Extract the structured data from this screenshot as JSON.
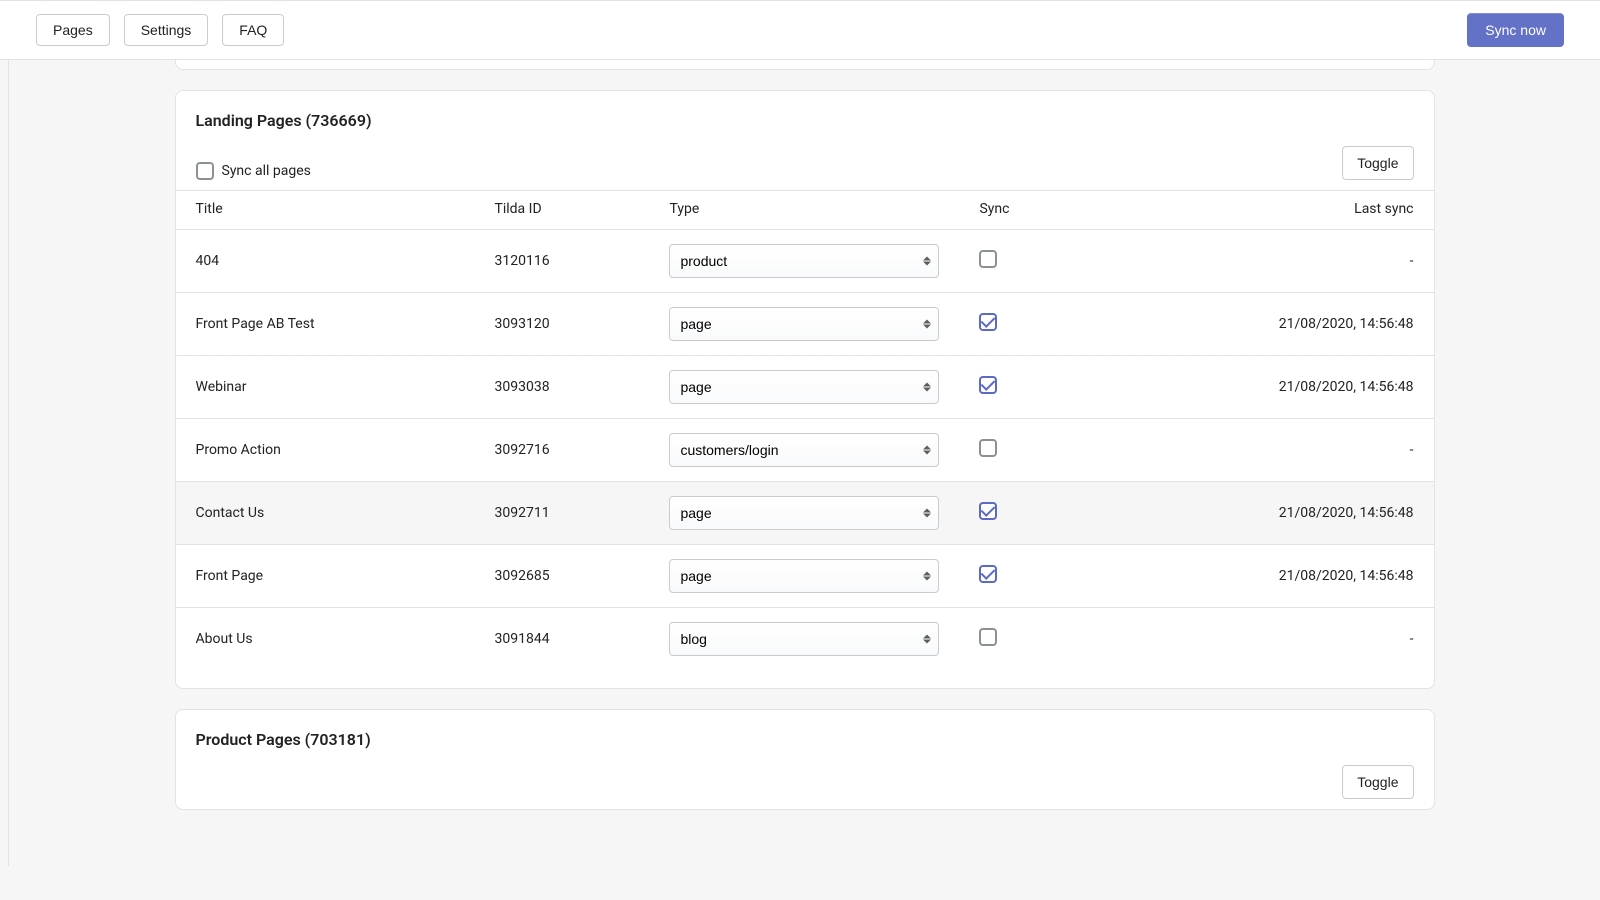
{
  "nav": {
    "pages": "Pages",
    "settings": "Settings",
    "faq": "FAQ",
    "sync_now": "Sync now"
  },
  "sections": [
    {
      "title": "Landing Pages (736669)",
      "sync_all_label": "Sync all pages",
      "toggle_label": "Toggle",
      "headers": {
        "title": "Title",
        "tilda": "Tilda ID",
        "type": "Type",
        "sync": "Sync",
        "last": "Last sync"
      },
      "rows": [
        {
          "title": "404",
          "tilda": "3120116",
          "type": "product",
          "sync": false,
          "last": "-",
          "hl": false
        },
        {
          "title": "Front Page AB Test",
          "tilda": "3093120",
          "type": "page",
          "sync": true,
          "last": "21/08/2020, 14:56:48",
          "hl": false
        },
        {
          "title": "Webinar",
          "tilda": "3093038",
          "type": "page",
          "sync": true,
          "last": "21/08/2020, 14:56:48",
          "hl": false
        },
        {
          "title": "Promo Action",
          "tilda": "3092716",
          "type": "customers/login",
          "sync": false,
          "last": "-",
          "hl": false
        },
        {
          "title": "Contact Us",
          "tilda": "3092711",
          "type": "page",
          "sync": true,
          "last": "21/08/2020, 14:56:48",
          "hl": true
        },
        {
          "title": "Front Page",
          "tilda": "3092685",
          "type": "page",
          "sync": true,
          "last": "21/08/2020, 14:56:48",
          "hl": false
        },
        {
          "title": "About Us",
          "tilda": "3091844",
          "type": "blog",
          "sync": false,
          "last": "-",
          "hl": false
        }
      ],
      "show_table": true
    },
    {
      "title": "Product Pages (703181)",
      "toggle_label": "Toggle",
      "show_table": false
    }
  ],
  "type_options": [
    "product",
    "page",
    "customers/login",
    "blog"
  ]
}
